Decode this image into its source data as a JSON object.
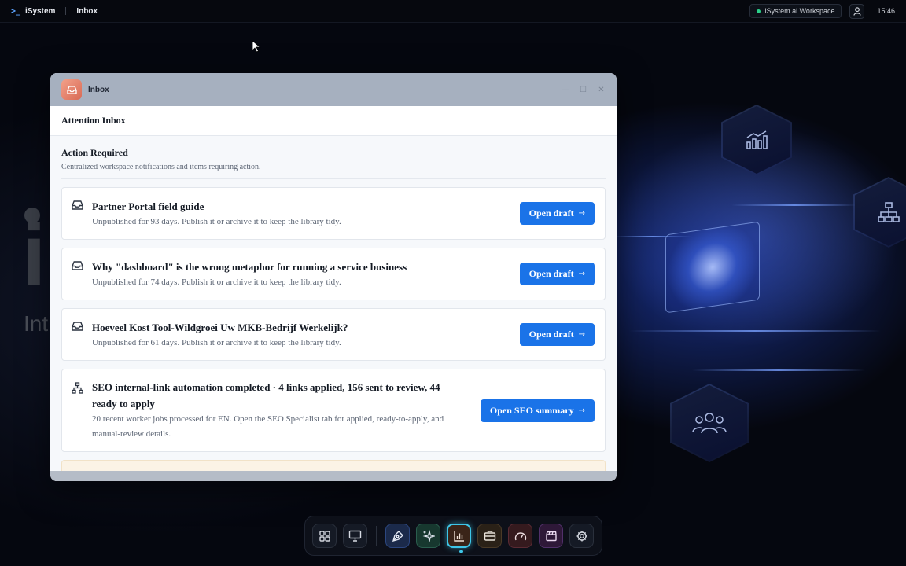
{
  "topbar": {
    "brand": "iSystem",
    "breadcrumb": "Inbox",
    "workspace": "iSystem.ai Workspace",
    "clock": "15:46"
  },
  "background": {
    "big_text": "i",
    "small_text": "Int"
  },
  "window": {
    "title": "Inbox",
    "header": "Attention Inbox",
    "section_title": "Action Required",
    "section_desc": "Centralized workspace notifications and items requiring action.",
    "items": [
      {
        "icon": "inbox-icon",
        "title": "Partner Portal field guide",
        "subtitle": "Unpublished for 93 days. Publish it or archive it to keep the library tidy.",
        "action": "Open draft"
      },
      {
        "icon": "inbox-icon",
        "title": "Why \"dashboard\" is the wrong metaphor for running a service business",
        "subtitle": "Unpublished for 74 days. Publish it or archive it to keep the library tidy.",
        "action": "Open draft"
      },
      {
        "icon": "inbox-icon",
        "title": "Hoeveel Kost Tool-Wildgroei Uw MKB-Bedrijf Werkelijk?",
        "subtitle": "Unpublished for 61 days. Publish it or archive it to keep the library tidy.",
        "action": "Open draft"
      },
      {
        "icon": "sitemap-icon",
        "title": "SEO internal-link automation completed · 4 links applied, 156 sent to review, 44 ready to apply",
        "subtitle": "20 recent worker jobs processed for EN. Open the SEO Specialist tab for applied, ready-to-apply, and manual-review details.",
        "action": "Open SEO summary"
      }
    ]
  },
  "dock": {
    "items": [
      {
        "icon": "grid-icon"
      },
      {
        "icon": "monitor-icon"
      },
      {
        "icon": "pen-tool-icon"
      },
      {
        "icon": "sparkles-icon"
      },
      {
        "icon": "bar-chart-icon",
        "active": true
      },
      {
        "icon": "briefcase-icon"
      },
      {
        "icon": "gauge-icon"
      },
      {
        "icon": "clapperboard-icon"
      },
      {
        "icon": "gear-icon"
      }
    ]
  },
  "colors": {
    "accent": "#1a73e8",
    "active_ring": "#3ec6e8",
    "status_dot": "#2bd18a"
  }
}
